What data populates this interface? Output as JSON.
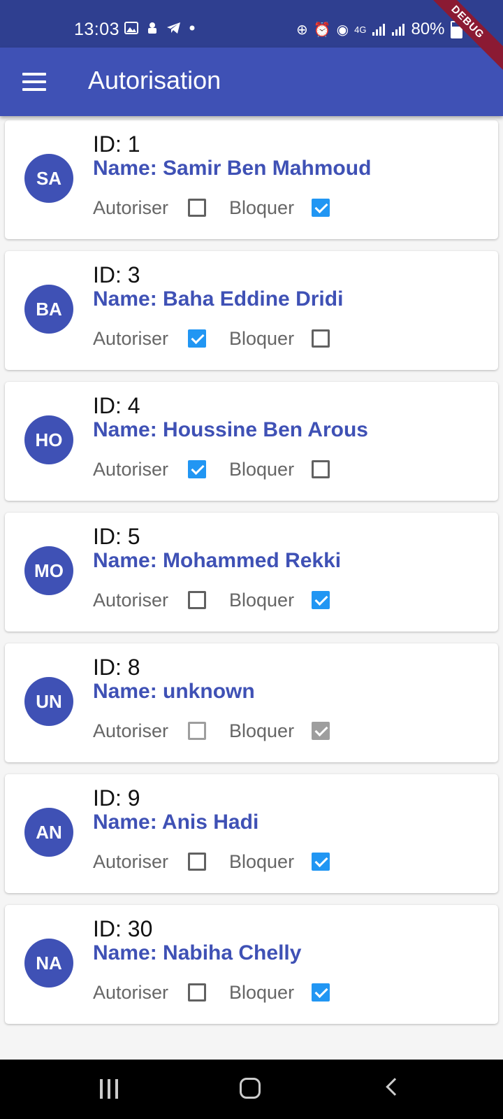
{
  "status_bar": {
    "time": "13:03",
    "left_icons": [
      "image-icon",
      "android-icon",
      "telegram-icon",
      "dot-icon"
    ],
    "right_icons": [
      "battery-saver-icon",
      "alarm-icon",
      "hotspot-icon",
      "network-4g-icon",
      "signal-icon",
      "signal-icon"
    ],
    "battery": "80%"
  },
  "debug_banner": "DEBUG",
  "app_bar": {
    "title": "Autorisation"
  },
  "labels": {
    "authorize": "Autoriser",
    "block": "Bloquer"
  },
  "users": [
    {
      "initials": "SA",
      "id": "ID: 1",
      "name": "Name: Samir Ben Mahmoud",
      "authorized": false,
      "blocked": true,
      "disabled": false
    },
    {
      "initials": "BA",
      "id": "ID: 3",
      "name": "Name: Baha Eddine Dridi",
      "authorized": true,
      "blocked": false,
      "disabled": false
    },
    {
      "initials": "HO",
      "id": "ID: 4",
      "name": "Name: Houssine Ben Arous",
      "authorized": true,
      "blocked": false,
      "disabled": false
    },
    {
      "initials": "MO",
      "id": "ID: 5",
      "name": "Name: Mohammed Rekki",
      "authorized": false,
      "blocked": true,
      "disabled": false
    },
    {
      "initials": "UN",
      "id": "ID: 8",
      "name": "Name: unknown",
      "authorized": false,
      "blocked": true,
      "disabled": true
    },
    {
      "initials": "AN",
      "id": "ID: 9",
      "name": "Name: Anis Hadi",
      "authorized": false,
      "blocked": true,
      "disabled": false
    },
    {
      "initials": "NA",
      "id": "ID: 30",
      "name": "Name: Nabiha Chelly",
      "authorized": false,
      "blocked": true,
      "disabled": false
    }
  ],
  "colors": {
    "primary": "#3f51b5",
    "status_bar": "#2f3f90",
    "checkbox_active": "#2196f3",
    "checkbox_disabled": "#9e9e9e"
  }
}
